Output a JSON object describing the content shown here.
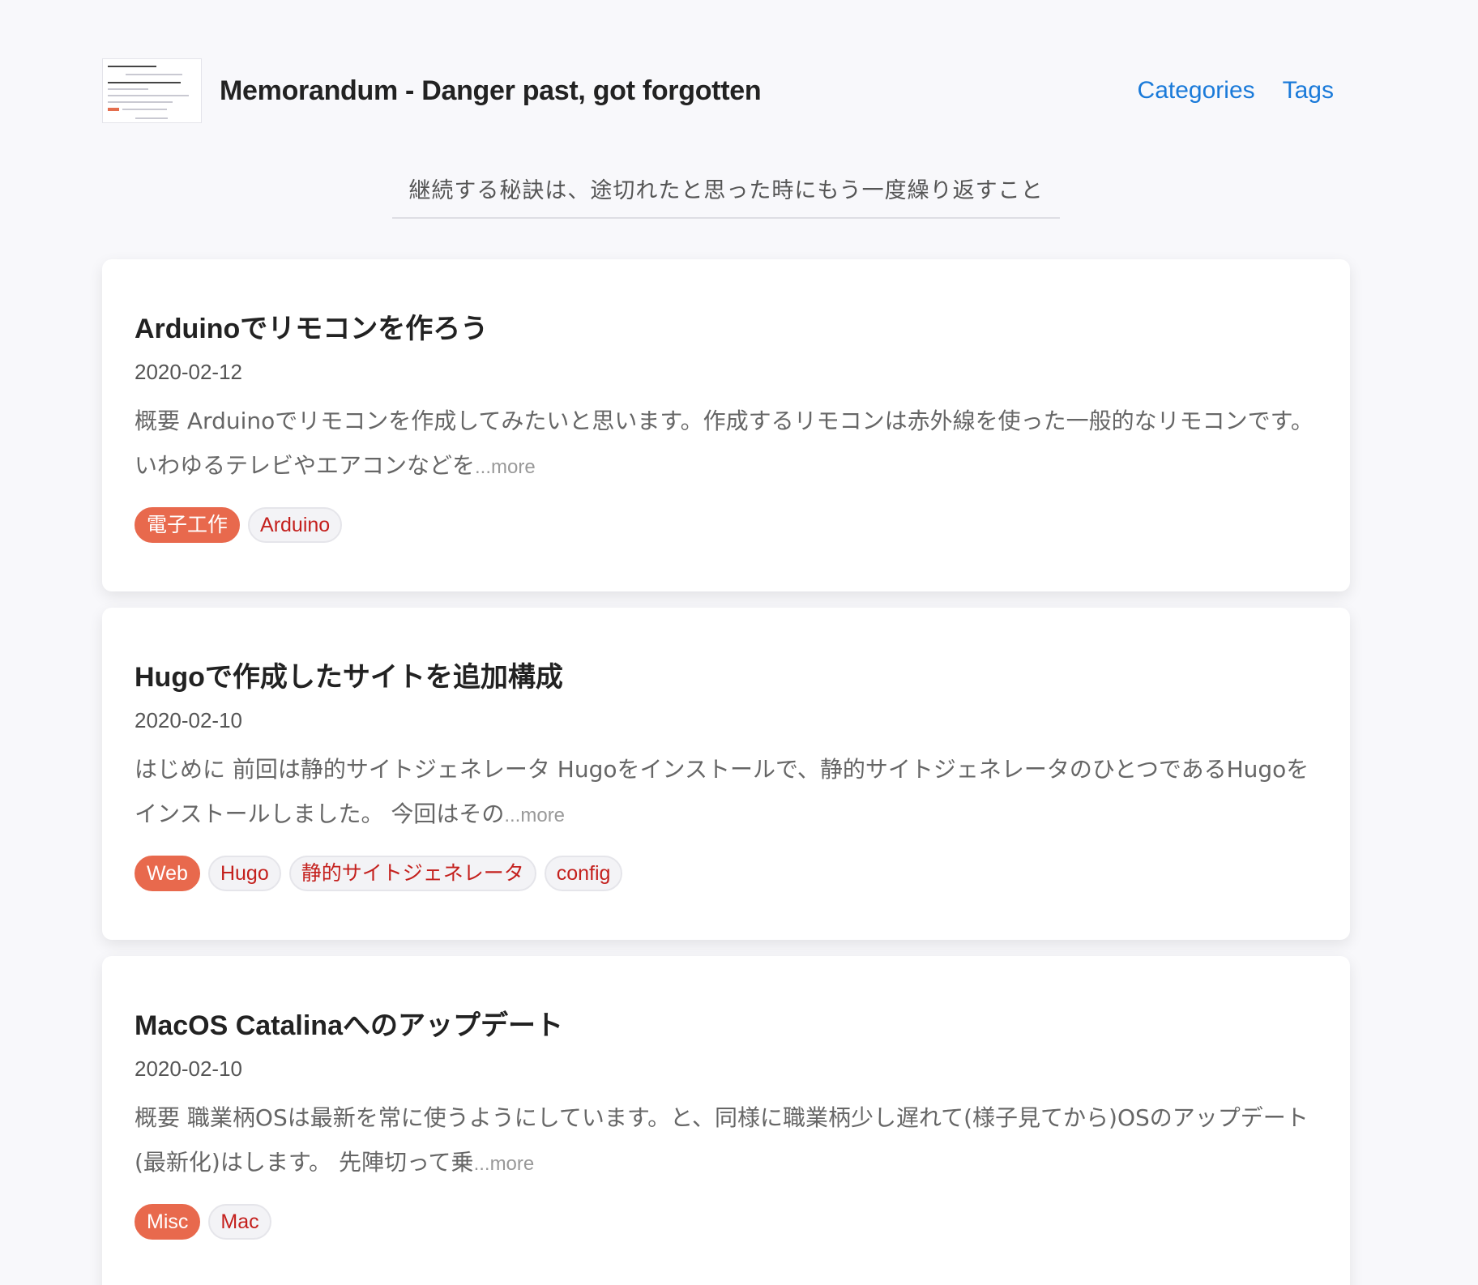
{
  "header": {
    "site_title": "Memorandum - Danger past, got forgotten",
    "nav": [
      {
        "label": "Categories"
      },
      {
        "label": "Tags"
      }
    ]
  },
  "tagline": "継続する秘訣は、途切れたと思った時にもう一度繰り返すこと",
  "posts": [
    {
      "title": "Arduinoでリモコンを作ろう",
      "date": "2020-02-12",
      "summary": "概要 Arduinoでリモコンを作成してみたいと思います。作成するリモコンは赤外線を使った一般的なリモコンです。いわゆるテレビやエアコンなどを",
      "more": "...more",
      "category": "電子工作",
      "tags": [
        "Arduino"
      ]
    },
    {
      "title": "Hugoで作成したサイトを追加構成",
      "date": "2020-02-10",
      "summary": "はじめに 前回は静的サイトジェネレータ Hugoをインストールで、静的サイトジェネレータのひとつであるHugoをインストールしました。 今回はその",
      "more": "...more",
      "category": "Web",
      "tags": [
        "Hugo",
        "静的サイトジェネレータ",
        "config"
      ]
    },
    {
      "title": "MacOS Catalinaへのアップデート",
      "date": "2020-02-10",
      "summary": "概要 職業柄OSは最新を常に使うようにしています。と、同様に職業柄少し遅れて(様子見てから)OSのアップデート(最新化)はします。 先陣切って乗",
      "more": "...more",
      "category": "Misc",
      "tags": [
        "Mac"
      ]
    }
  ],
  "colors": {
    "link": "#1a7ad9",
    "category_tag_bg": "#e8694d",
    "tag_text": "#c4201d",
    "page_bg": "#f8f8fb"
  }
}
